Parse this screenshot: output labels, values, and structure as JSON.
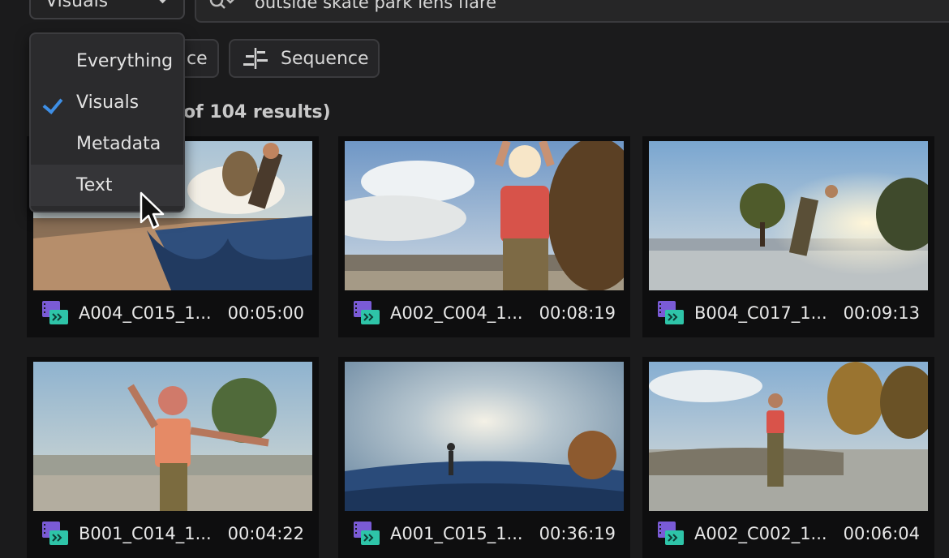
{
  "search": {
    "mode_label": "Visuals",
    "query": "outside skate park lens flare"
  },
  "filters": {
    "scene_label": "ce",
    "sequence_label": "Sequence"
  },
  "results_text": "of 104 results)",
  "dropdown": {
    "items": [
      {
        "label": "Everything",
        "checked": false
      },
      {
        "label": "Visuals",
        "checked": true
      },
      {
        "label": "Metadata",
        "checked": false
      },
      {
        "label": "Text",
        "checked": false,
        "hovered": true
      }
    ]
  },
  "clips": [
    {
      "name": "A004_C015_1...",
      "duration": "00:05:00"
    },
    {
      "name": "A002_C004_1...",
      "duration": "00:08:19"
    },
    {
      "name": "B004_C017_1...",
      "duration": "00:09:13"
    },
    {
      "name": "B001_C014_1...",
      "duration": "00:04:22"
    },
    {
      "name": "A001_C015_1...",
      "duration": "00:36:19"
    },
    {
      "name": "A002_C002_1...",
      "duration": "00:06:04"
    }
  ],
  "colors": {
    "accent_check": "#3e8fe6",
    "clip_icon_purple": "#7a5bd6",
    "clip_icon_teal": "#2ec4a8"
  },
  "icons": {
    "search": "search-icon",
    "sequence": "sequence-icon",
    "clip": "clip-icon",
    "check": "check-icon",
    "cursor": "cursor-icon"
  }
}
